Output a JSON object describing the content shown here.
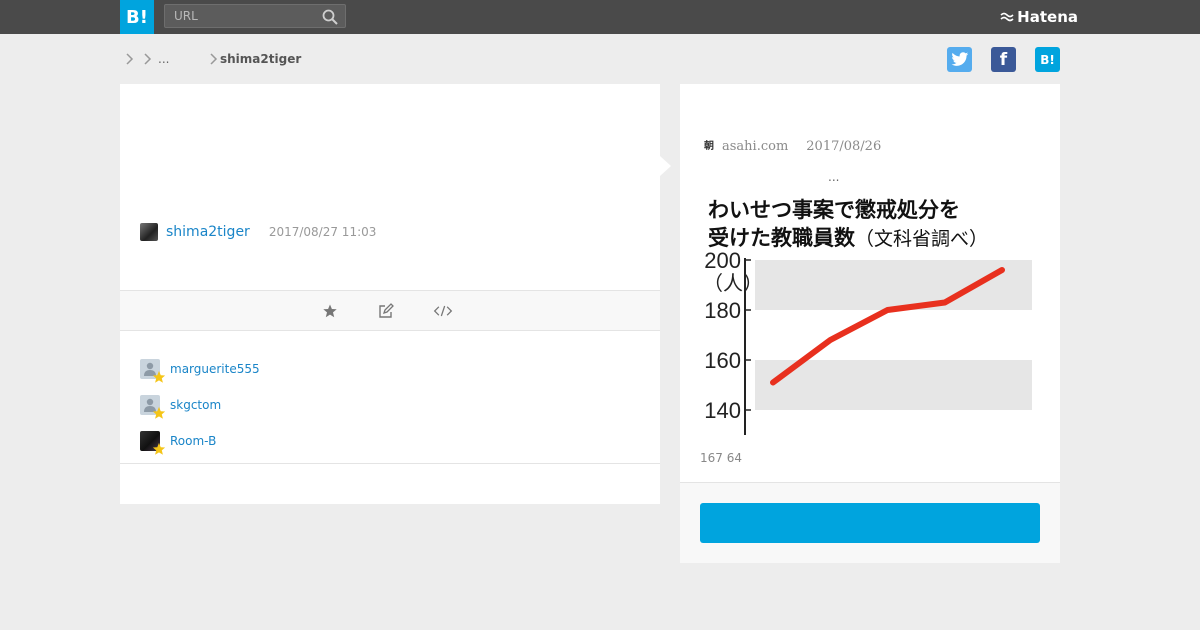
{
  "header": {
    "logo_text": "B!",
    "search_placeholder": "URL",
    "brand": "Hatena",
    "colors": {
      "bar": "#4a4a4a",
      "accent": "#00a4de"
    }
  },
  "breadcrumb": {
    "ellipsis": "...",
    "user": "shima2tiger"
  },
  "share": {
    "facebook_glyph": "f",
    "hatena_glyph": "B!"
  },
  "bookmark": {
    "username": "shima2tiger",
    "timestamp": "2017/08/27 11:03"
  },
  "stars": [
    {
      "name": "marguerite555",
      "avatar": "default"
    },
    {
      "name": "skgctom",
      "avatar": "default"
    },
    {
      "name": "Room-B",
      "avatar": "dark"
    }
  ],
  "entry": {
    "favicon_glyph": "朝",
    "source": "asahi.com",
    "date": "2017/08/26",
    "ellipsis": "...",
    "counts": "167 64",
    "cta_label": ""
  },
  "chart_data": {
    "type": "line",
    "title_line1": "わいせつ事案で懲戒処分を",
    "title_line2": "受けた教職員数",
    "title_paren": "（文科省調べ）",
    "ylabel": "（人）",
    "yticks": [
      200,
      180,
      160,
      140
    ],
    "ylim": [
      134,
      200
    ],
    "bands": [
      [
        180,
        200
      ],
      [
        140,
        160
      ]
    ],
    "series": [
      {
        "values": [
          151,
          168,
          180,
          183,
          196
        ]
      }
    ],
    "colors": {
      "line": "#e8301e",
      "band": "#e6e6e6"
    }
  }
}
